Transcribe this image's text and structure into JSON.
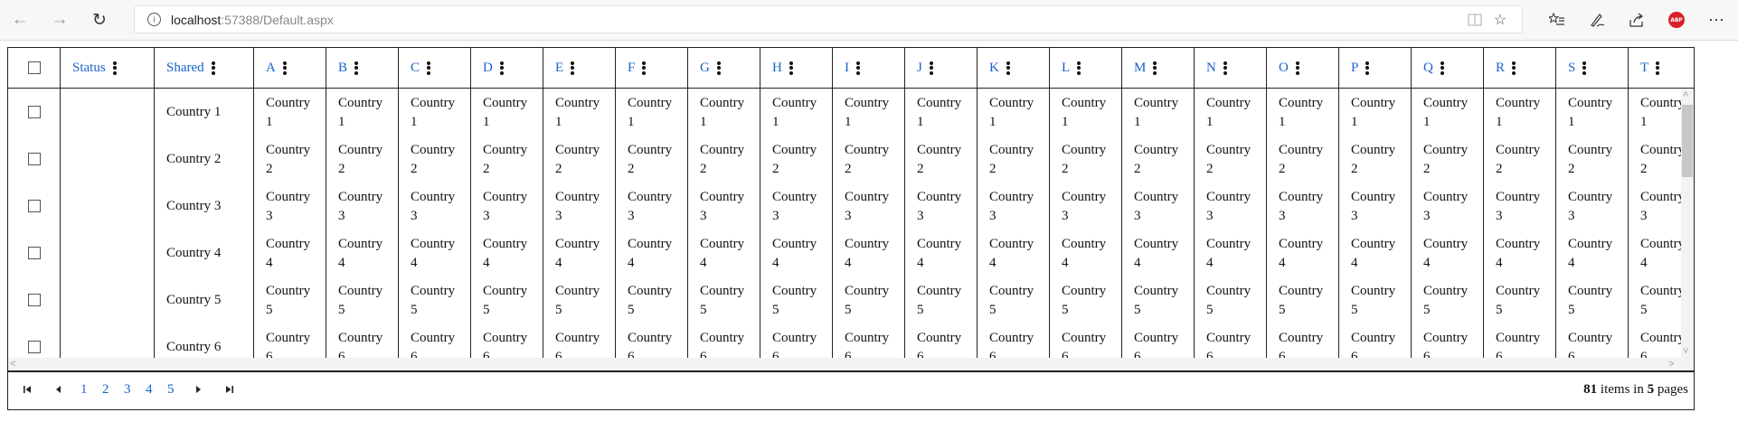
{
  "browser": {
    "url_host": "localhost",
    "url_rest": ":57388/Default.aspx"
  },
  "grid": {
    "columns": [
      "",
      "Status",
      "Shared",
      "A",
      "B",
      "C",
      "D",
      "E",
      "F",
      "G",
      "H",
      "I",
      "J",
      "K",
      "L",
      "M",
      "N",
      "O",
      "P",
      "Q",
      "R",
      "S",
      "T"
    ],
    "rows": [
      {
        "shared": "Country 1",
        "cell_word": "Country",
        "cell_num": "1"
      },
      {
        "shared": "Country 2",
        "cell_word": "Country",
        "cell_num": "2"
      },
      {
        "shared": "Country 3",
        "cell_word": "Country",
        "cell_num": "3"
      },
      {
        "shared": "Country 4",
        "cell_word": "Country",
        "cell_num": "4"
      },
      {
        "shared": "Country 5",
        "cell_word": "Country",
        "cell_num": "5"
      },
      {
        "shared": "Country 6",
        "cell_word": "Country",
        "cell_num": "6"
      }
    ]
  },
  "pager": {
    "pages": [
      "1",
      "2",
      "3",
      "4",
      "5"
    ],
    "total_items": "81",
    "items_text": " items in ",
    "total_pages": "5",
    "pages_text": " pages"
  }
}
